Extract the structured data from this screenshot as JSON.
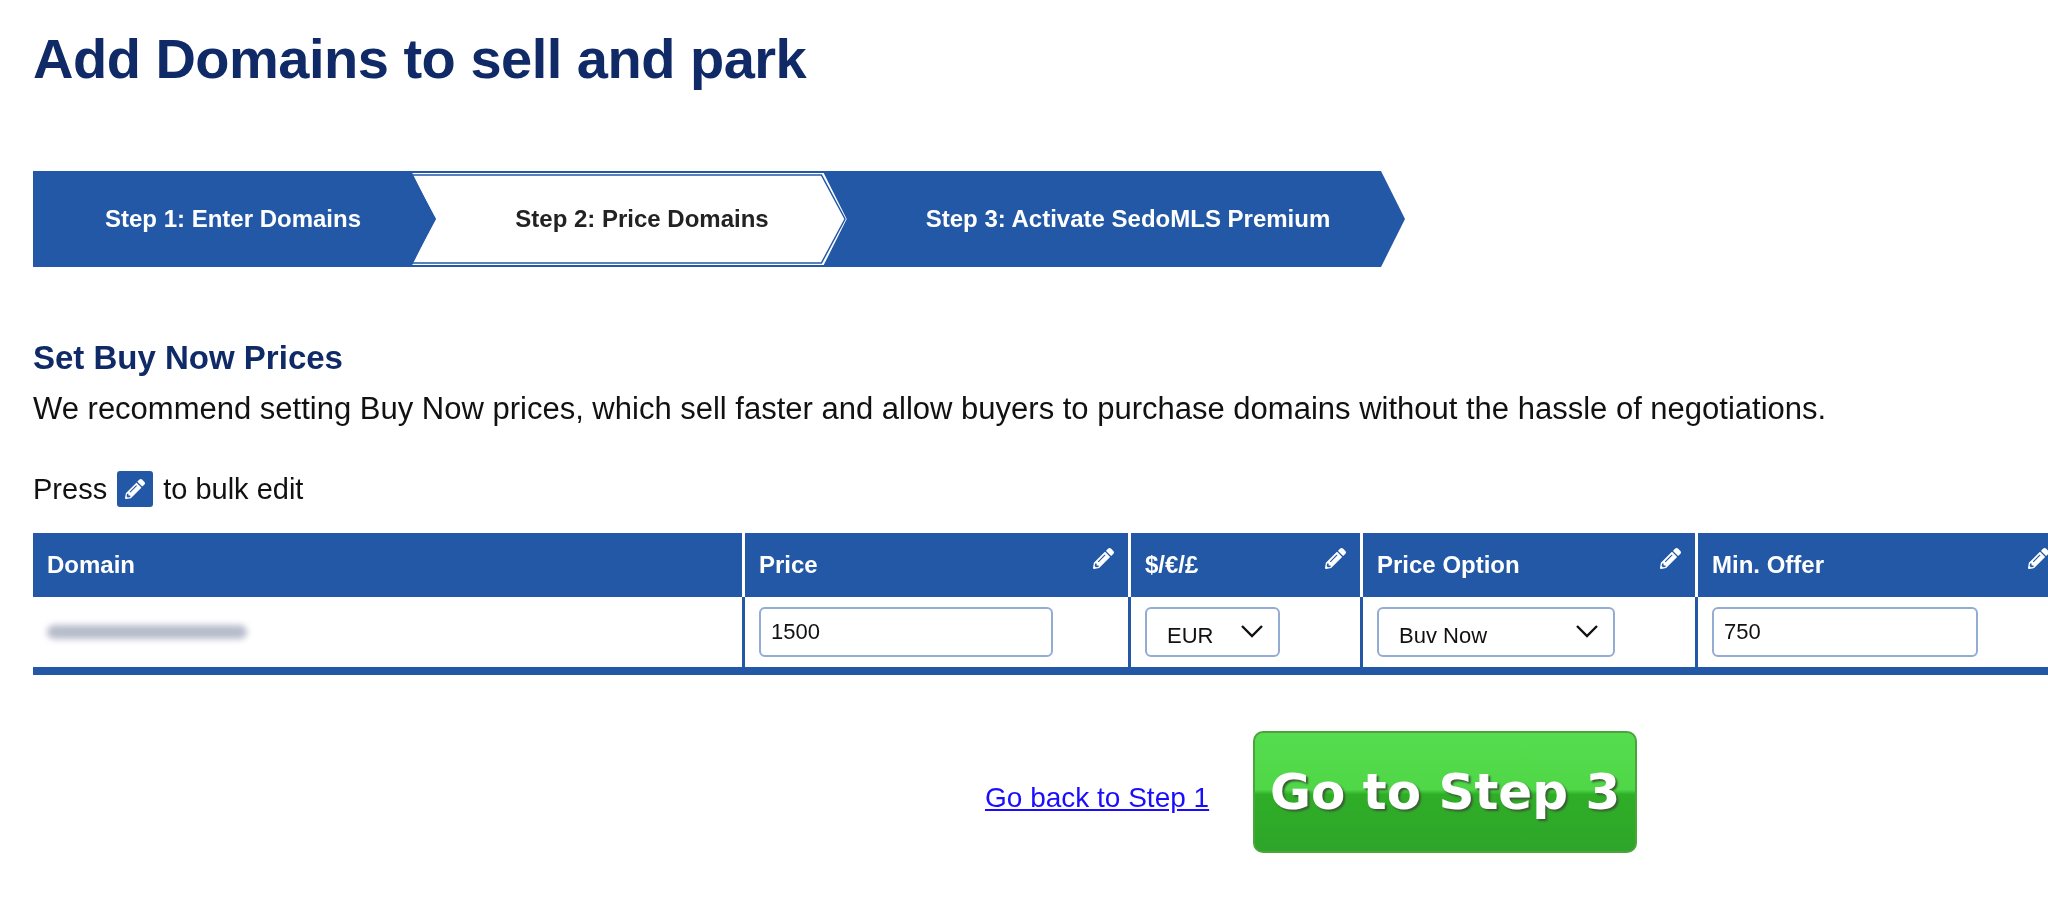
{
  "page": {
    "title": "Add Domains to sell and park"
  },
  "steps": [
    {
      "label": "Step 1: Enter Domains",
      "selected": false
    },
    {
      "label": "Step 2: Price Domains",
      "selected": true
    },
    {
      "label": "Step 3: Activate SedoMLS Premium",
      "selected": false
    }
  ],
  "section": {
    "heading": "Set Buy Now Prices",
    "description": "We recommend setting Buy Now prices, which sell faster and allow buyers to purchase domains without the hassle of negotiations.",
    "bulk_edit_before": "Press",
    "bulk_edit_after": "to bulk edit"
  },
  "table": {
    "columns": [
      {
        "label": "Domain",
        "editable": false
      },
      {
        "label": "Price",
        "editable": true
      },
      {
        "label": "$/€/£",
        "editable": true
      },
      {
        "label": "Price Option",
        "editable": true
      },
      {
        "label": "Min. Offer",
        "editable": true
      }
    ],
    "rows": [
      {
        "domain_blurred": true,
        "price": "1500",
        "currency": "EUR",
        "price_option": "Buv Now",
        "min_offer": "750"
      }
    ]
  },
  "actions": {
    "back_link": "Go back to Step 1",
    "next_button": "Go to Step 3"
  }
}
